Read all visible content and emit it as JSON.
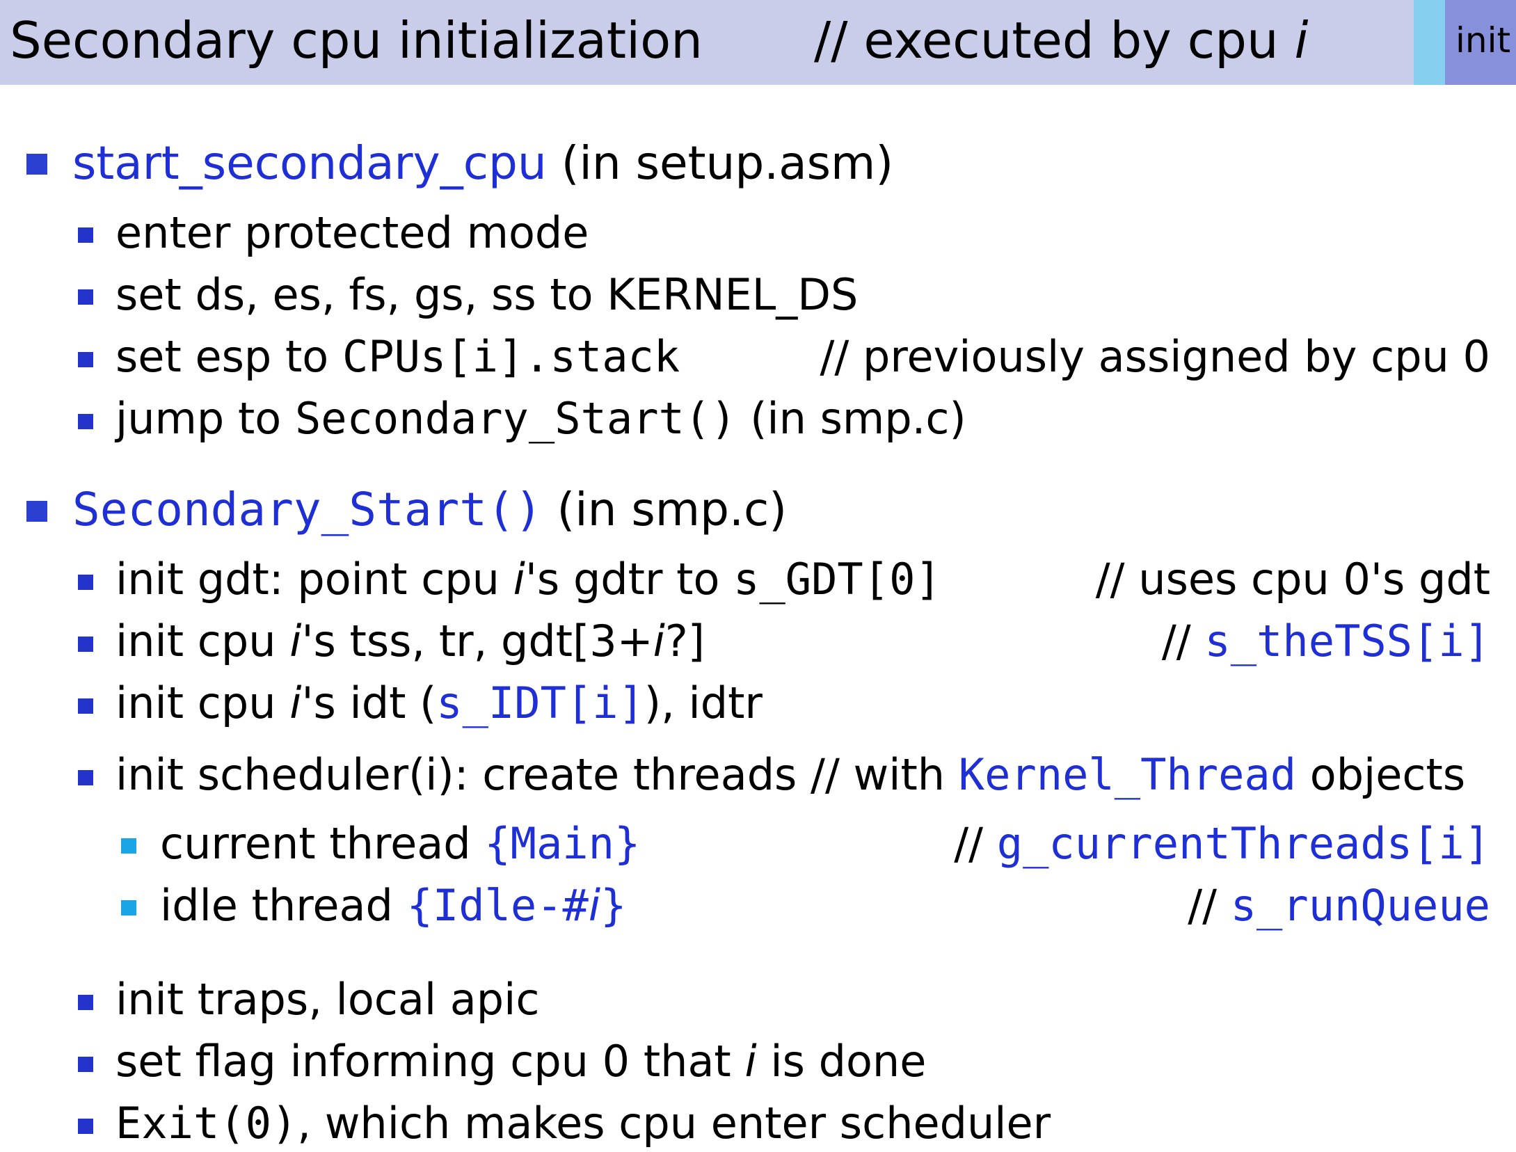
{
  "header": {
    "title": "Secondary cpu initialization",
    "comment_prefix": "// executed by cpu ",
    "comment_var": "i",
    "tab_label": "init"
  },
  "colors": {
    "header_bg": "#c9cdea",
    "code_blue": "#1f2fd6",
    "bullet_blue": "#2b3fd1",
    "bullet_cyan": "#1aa6e6",
    "tab_light": "#87cfef",
    "tab_dark": "#8791db"
  },
  "sections": [
    {
      "heading_code": "start_secondary_cpu",
      "heading_rest": " (in setup.asm)",
      "items": [
        {
          "text": "enter protected mode"
        },
        {
          "text": "set ds, es, fs, gs, ss to KERNEL_DS"
        },
        {
          "pre": "set esp to ",
          "code": "CPUs[i].stack",
          "comment": "// previously assigned by cpu 0"
        },
        {
          "pre": "jump to ",
          "code": "Secondary_Start()",
          "post": " (in smp.c)"
        }
      ]
    },
    {
      "heading_code": "Secondary_Start()",
      "heading_rest": " (in smp.c)",
      "items": [
        {
          "pre": "init gdt:  point cpu ",
          "var": "i",
          "mid": "'s gdtr to ",
          "code": "s_GDT[0]",
          "comment": "// uses cpu 0's gdt"
        },
        {
          "pre": "init cpu ",
          "var": "i",
          "mid": "'s tss, tr, gdt[3+",
          "var2": "i",
          "post": "?]",
          "comment_prefix": "// ",
          "comment_code": "s_theTSS[i]"
        },
        {
          "pre": "init cpu ",
          "var": "i",
          "mid": "'s idt (",
          "code": "s_IDT[i]",
          "post": "), idtr"
        },
        {
          "pre": "init scheduler(i):  create threads // with ",
          "code": "Kernel_Thread",
          "post": " objects",
          "subitems": [
            {
              "pre": "current thread ",
              "code": "{Main}",
              "comment_prefix": "// ",
              "comment_code": "g_currentThreads[i]"
            },
            {
              "pre": "idle thread ",
              "code": "{Idle-#",
              "var": "i",
              "code2": "}",
              "comment_prefix": "// ",
              "comment_code": "s_runQueue"
            }
          ]
        },
        {
          "text": "init traps, local apic"
        },
        {
          "pre": "set flag informing cpu 0 that ",
          "var": "i",
          "post": " is done"
        },
        {
          "code_black": "Exit(0)",
          "post": ", which makes cpu enter scheduler"
        }
      ]
    }
  ]
}
